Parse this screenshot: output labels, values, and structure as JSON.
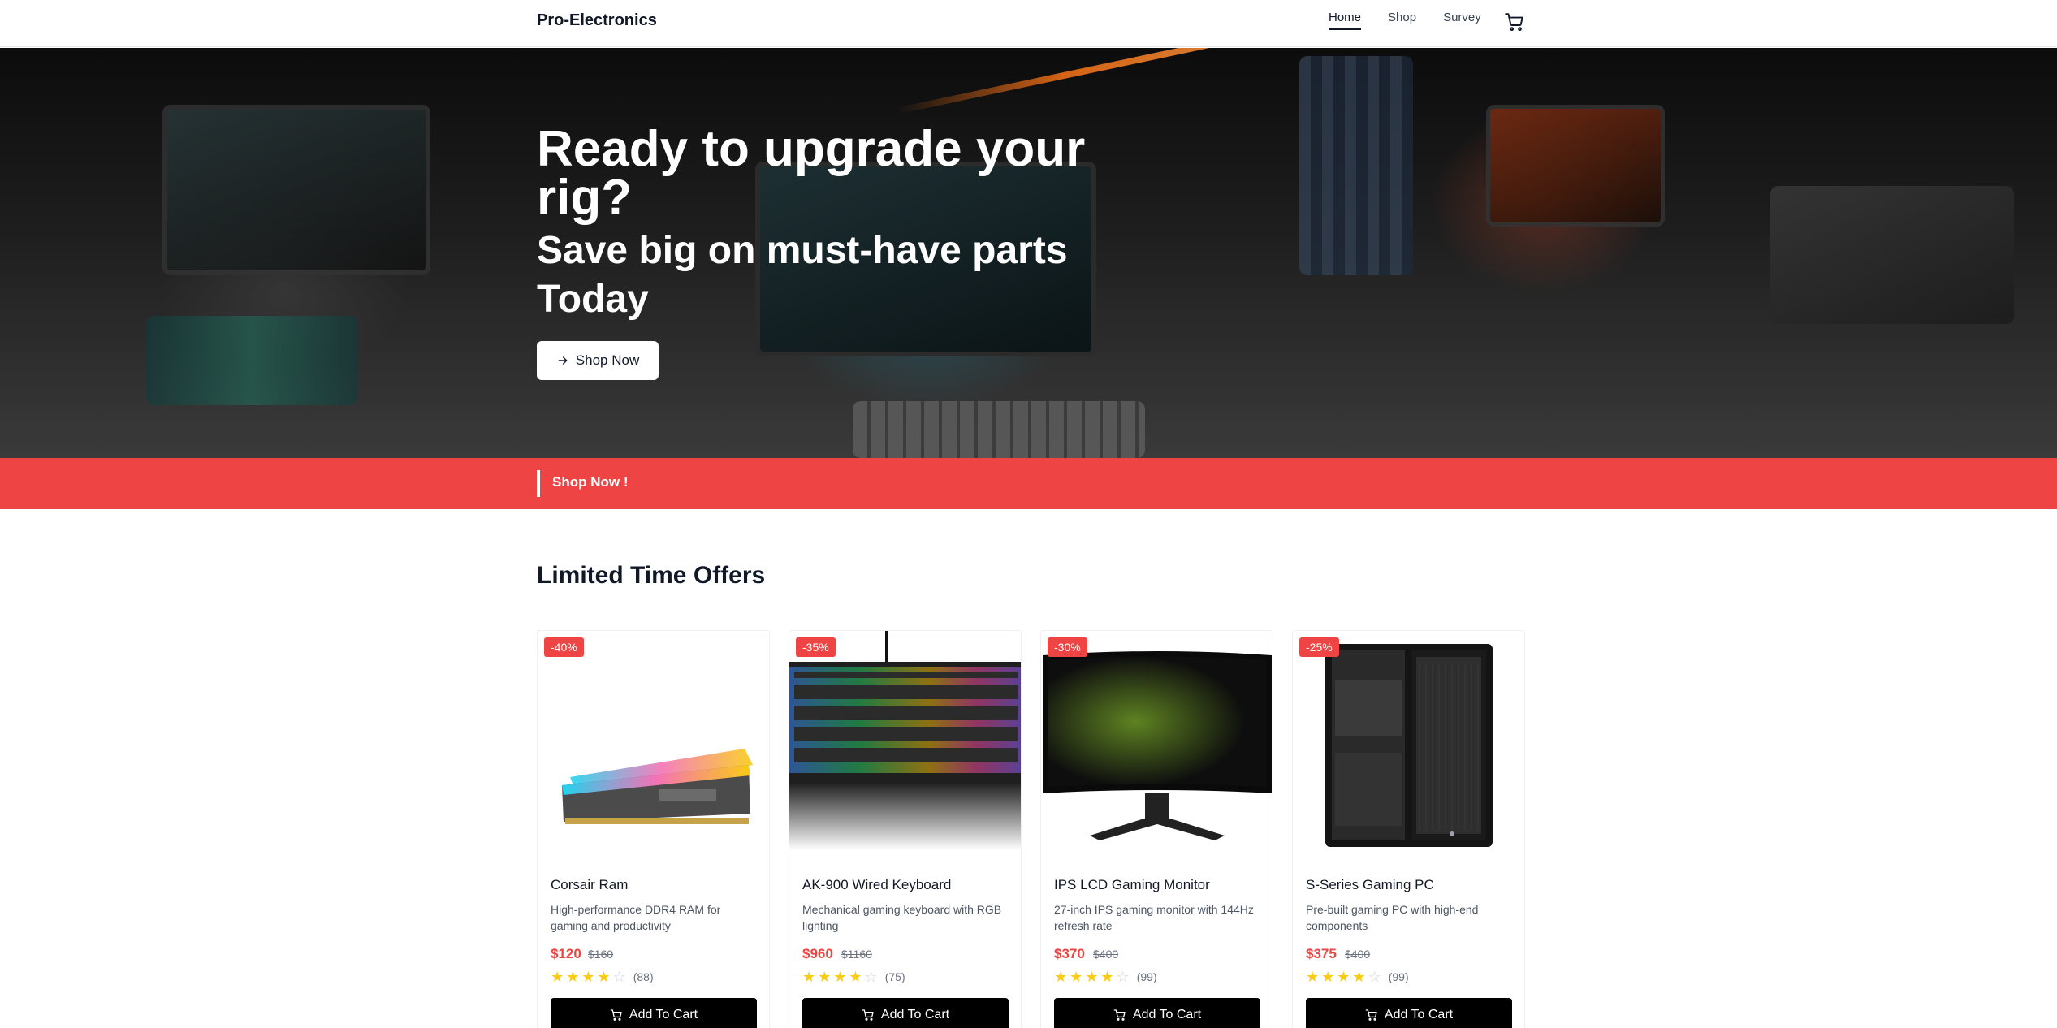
{
  "nav": {
    "brand": "Pro-Electronics",
    "links": [
      {
        "label": "Home",
        "active": true
      },
      {
        "label": "Shop",
        "active": false
      },
      {
        "label": "Survey",
        "active": false
      }
    ],
    "cart_icon": "cart-icon"
  },
  "hero": {
    "title": "Ready to upgrade your rig?",
    "subtitle": "Save big on must-have parts Today",
    "button_label": "Shop Now",
    "button_icon": "arrow-right-icon"
  },
  "banner": {
    "text": "Shop Now !",
    "color": "#ef4444"
  },
  "offers": {
    "title": "Limited Time Offers",
    "add_label": "Add To Cart",
    "products": [
      {
        "badge": "-40%",
        "name": "Corsair Ram",
        "desc": "High-performance DDR4 RAM for gaming and productivity",
        "price": "$120",
        "old_price": "$160",
        "rating": 4,
        "count": "(88)"
      },
      {
        "badge": "-35%",
        "name": "AK-900 Wired Keyboard",
        "desc": "Mechanical gaming keyboard with RGB lighting",
        "price": "$960",
        "old_price": "$1160",
        "rating": 4,
        "count": "(75)"
      },
      {
        "badge": "-30%",
        "name": "IPS LCD Gaming Monitor",
        "desc": "27-inch IPS gaming monitor with 144Hz refresh rate",
        "price": "$370",
        "old_price": "$400",
        "rating": 4,
        "count": "(99)"
      },
      {
        "badge": "-25%",
        "name": "S-Series Gaming PC",
        "desc": "Pre-built gaming PC with high-end components",
        "price": "$375",
        "old_price": "$400",
        "rating": 4,
        "count": "(99)"
      }
    ]
  },
  "colors": {
    "accent": "#ef4444",
    "star": "#facc15",
    "button": "#000000"
  }
}
